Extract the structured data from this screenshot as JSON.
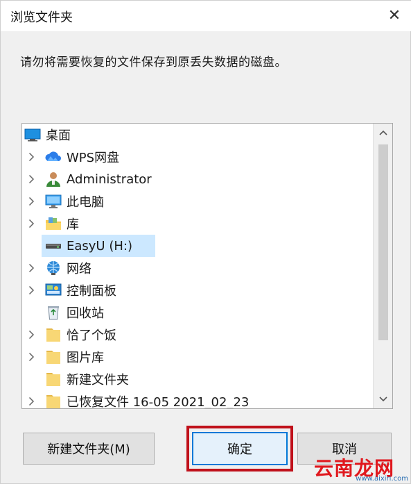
{
  "window": {
    "title": "浏览文件夹",
    "close_glyph": "✕"
  },
  "instruction": "请勿将需要恢复的文件保存到原丢失数据的磁盘。",
  "tree": {
    "items": [
      {
        "label": "桌面",
        "icon": "desktop-icon",
        "expandable": false,
        "level": 0
      },
      {
        "label": "WPS网盘",
        "icon": "cloud-icon",
        "expandable": true,
        "level": 1
      },
      {
        "label": "Administrator",
        "icon": "user-icon",
        "expandable": true,
        "level": 1
      },
      {
        "label": "此电脑",
        "icon": "computer-icon",
        "expandable": true,
        "level": 1
      },
      {
        "label": "库",
        "icon": "library-icon",
        "expandable": true,
        "level": 1
      },
      {
        "label": "EasyU (H:)",
        "icon": "drive-icon",
        "expandable": false,
        "level": 1,
        "selected": true
      },
      {
        "label": "网络",
        "icon": "network-icon",
        "expandable": true,
        "level": 1
      },
      {
        "label": "控制面板",
        "icon": "control-panel-icon",
        "expandable": true,
        "level": 1
      },
      {
        "label": "回收站",
        "icon": "recycle-bin-icon",
        "expandable": false,
        "level": 1
      },
      {
        "label": "恰了个饭",
        "icon": "folder-icon",
        "expandable": true,
        "level": 1
      },
      {
        "label": "图片库",
        "icon": "folder-icon",
        "expandable": true,
        "level": 1
      },
      {
        "label": "新建文件夹",
        "icon": "folder-icon",
        "expandable": false,
        "level": 1
      },
      {
        "label": "已恢复文件 16-05 2021_02_23",
        "icon": "folder-icon",
        "expandable": true,
        "level": 1
      }
    ]
  },
  "buttons": {
    "new_folder": "新建文件夹(M)",
    "ok": "确定",
    "cancel": "取消"
  },
  "watermark": {
    "text": "云南龙网",
    "url": "www.aixiri.com"
  },
  "colors": {
    "selection": "#cce8ff",
    "ok_border": "#0078d7",
    "highlight_frame": "#c0101a",
    "folder": "#f8d775"
  }
}
